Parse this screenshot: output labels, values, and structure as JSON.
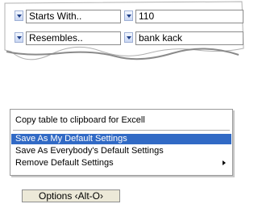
{
  "filters": [
    {
      "operator": "Starts With..",
      "value": "110"
    },
    {
      "operator": "Resembles..",
      "value": "bank kack"
    }
  ],
  "menu": {
    "items": [
      {
        "label": "Copy table to clipboard for Excell",
        "highlighted": false
      },
      {
        "label": "Save As My Default Settings",
        "highlighted": true
      },
      {
        "label": "Save As Everybody's Default Settings",
        "highlighted": false
      },
      {
        "label": "Remove Default Settings",
        "highlighted": false,
        "submenu": true
      }
    ]
  },
  "options_button": {
    "label": "Options ‹Alt-O›"
  },
  "icons": [
    "chevron-down-icon",
    "submenu-arrow-icon"
  ],
  "colors": {
    "highlight": "#316ac5",
    "dropdown_arrow": "#1f3f87"
  }
}
